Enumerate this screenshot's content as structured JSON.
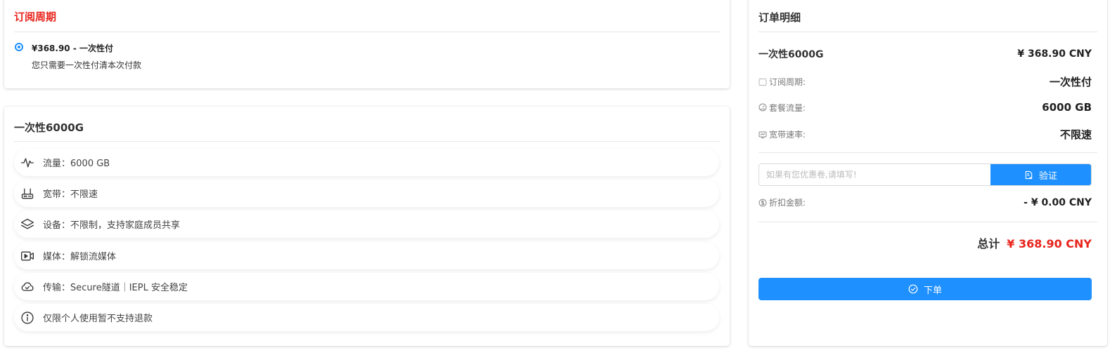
{
  "cycle": {
    "title": "订阅周期",
    "option_label": "¥368.90 - 一次性付",
    "option_desc": "您只需要一次性付清本次付款",
    "selected": true
  },
  "plan": {
    "title": "一次性6000G",
    "features": [
      {
        "icon": "activity-icon",
        "text": "流量：6000 GB"
      },
      {
        "icon": "router-icon",
        "text": "宽带：不限速"
      },
      {
        "icon": "layers-icon",
        "text": "设备：不限制，支持家庭成员共享"
      },
      {
        "icon": "video-icon",
        "text": "媒体：解锁流媒体"
      },
      {
        "icon": "cloud-check-icon",
        "text": "传输：Secure隧道｜IEPL 安全稳定"
      },
      {
        "icon": "info-icon",
        "text": "仅限个人使用暂不支持退款"
      }
    ]
  },
  "order": {
    "title": "订单明细",
    "item_name": "一次性6000G",
    "item_price": "¥ 368.90 CNY",
    "details": [
      {
        "icon": "calendar-icon",
        "label": "订阅周期:",
        "value": "一次性付"
      },
      {
        "icon": "gauge-icon",
        "label": "套餐流量:",
        "value": "6000 GB"
      },
      {
        "icon": "monitor-icon",
        "label": "宽带速率:",
        "value": "不限速"
      }
    ],
    "coupon_placeholder": "如果有您优惠卷,请填写!",
    "coupon_value": "",
    "verify_label": "验证",
    "discount_label": "折扣金额:",
    "discount_value": "- ¥ 0.00 CNY",
    "total_label": "总计",
    "total_value": "¥ 368.90 CNY",
    "order_button_label": "下单"
  },
  "colors": {
    "accent": "#1e90ff",
    "price_red": "#e8231b"
  }
}
